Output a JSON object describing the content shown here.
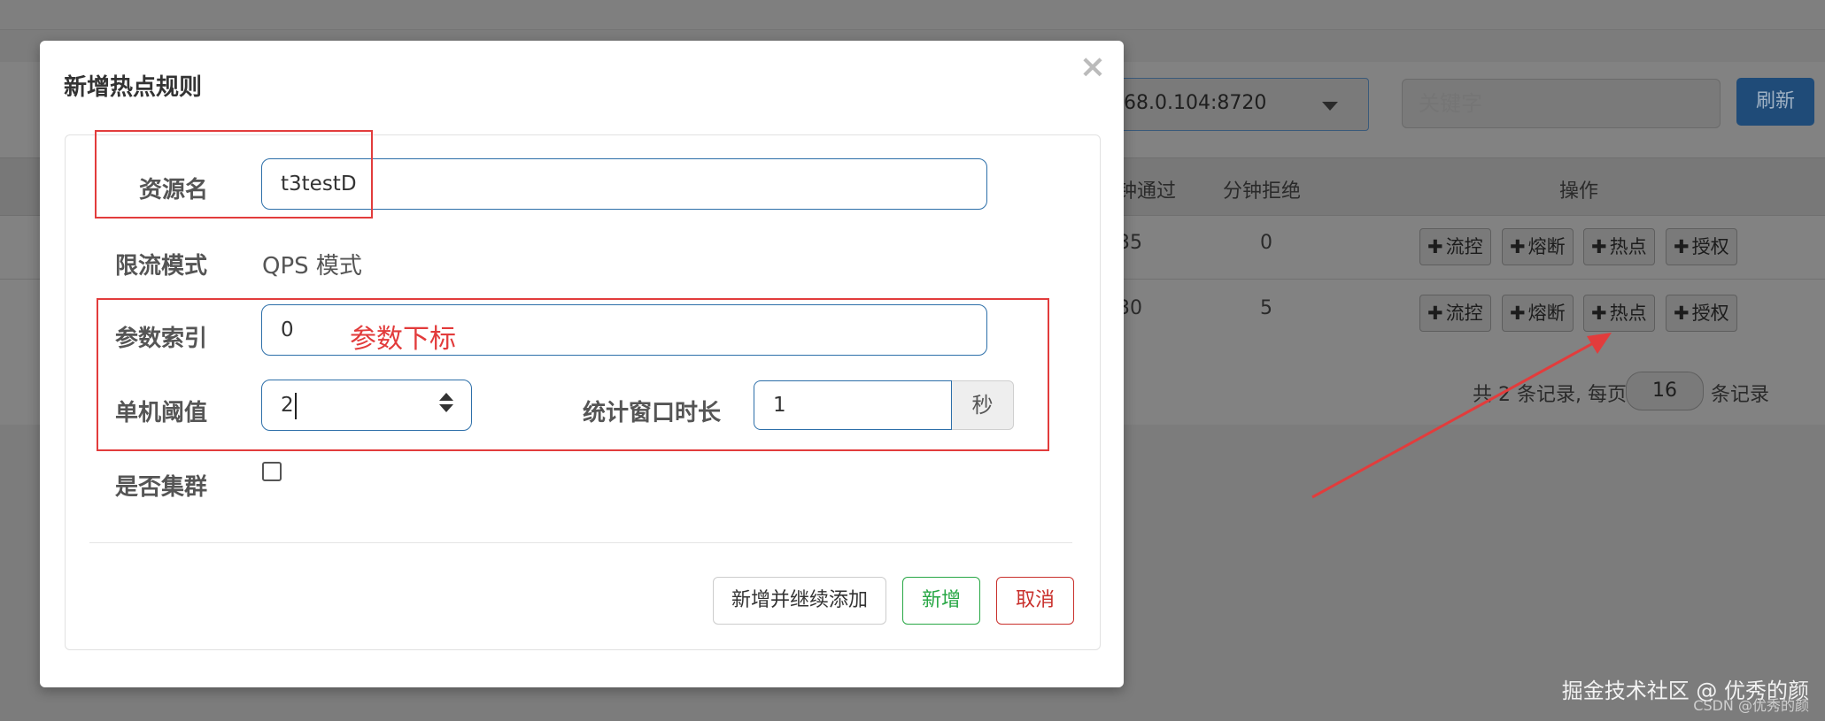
{
  "background": {
    "instance_select_value": "68.0.104:8720",
    "search_placeholder": "关键字",
    "refresh_label": "刷新",
    "columns": {
      "pass_per_min": "钟通过",
      "reject_per_min": "分钟拒绝",
      "actions": "操作"
    },
    "rows": [
      {
        "pass": "35",
        "reject": "0"
      },
      {
        "pass": "30",
        "reject": "5"
      }
    ],
    "row_actions": [
      "流控",
      "熔断",
      "热点",
      "授权"
    ],
    "pagination": {
      "prefix": "共 2 条记录, 每页",
      "page_size": "16",
      "suffix": "条记录"
    }
  },
  "modal": {
    "title": "新增热点规则",
    "close_symbol": "×",
    "resource_label": "资源名",
    "resource_value": "t3testD",
    "mode_label": "限流模式",
    "mode_value": "QPS 模式",
    "param_index_label": "参数索引",
    "param_index_value": "0",
    "param_index_note": "参数下标",
    "threshold_label": "单机阈值",
    "threshold_value": "2",
    "window_label": "统计窗口时长",
    "window_value": "1",
    "window_unit": "秒",
    "cluster_label": "是否集群",
    "cluster_checked": false,
    "buttons": {
      "add_continue": "新增并继续添加",
      "add": "新增",
      "cancel": "取消"
    }
  },
  "colors": {
    "annotation_red": "#e23c3c",
    "primary_blue": "#2d6fa9",
    "success_green": "#28a745",
    "danger_red": "#c9302c"
  },
  "watermark": {
    "main": "掘金技术社区 @ 优秀的颜",
    "sub": "CSDN @优秀的颜"
  }
}
